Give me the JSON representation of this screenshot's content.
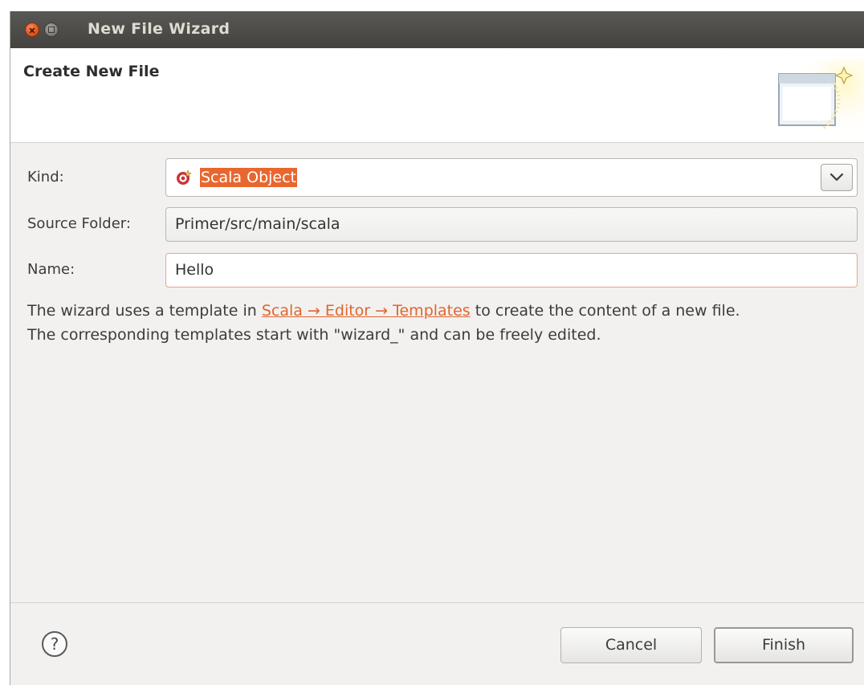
{
  "window": {
    "title": "New File Wizard"
  },
  "banner": {
    "title": "Create New File"
  },
  "form": {
    "kind_label": "Kind:",
    "kind_value": "Scala Object",
    "source_folder_label": "Source Folder:",
    "source_folder_value": "Primer/src/main/scala",
    "name_label": "Name:",
    "name_value": "Hello"
  },
  "description": {
    "line1_before": "The wizard uses a template in ",
    "link_text": "Scala → Editor → Templates",
    "line1_after": " to create the content of a new file.",
    "line2": "The corresponding templates start with \"wizard_\" and can be freely edited."
  },
  "buttons": {
    "cancel": "Cancel",
    "finish": "Finish"
  },
  "icons": {
    "close": "close-icon",
    "maximize": "maximize-icon",
    "wizard_banner": "new-file-wizard-icon",
    "kind": "scala-object-icon",
    "dropdown": "chevron-down-icon",
    "help": "help-icon"
  },
  "colors": {
    "accent": "#e8672f",
    "titlebar": "#4a4844",
    "dialog_bg": "#f2f1f0"
  }
}
